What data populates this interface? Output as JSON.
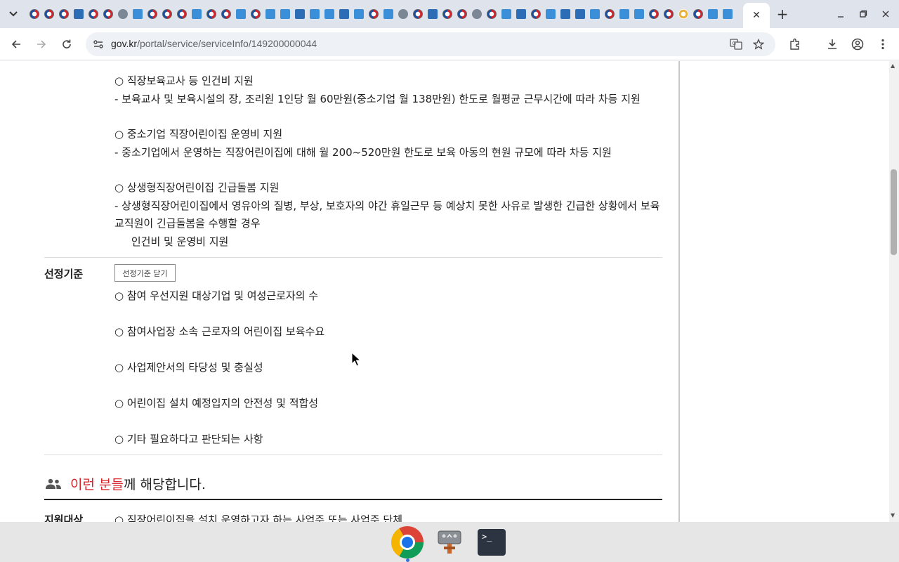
{
  "browser": {
    "tab_count_icons": 48,
    "active_tab_close": "✕",
    "new_tab": "+",
    "url_host": "gov.kr",
    "url_path": "/portal/service/serviceInfo/149200000044"
  },
  "content": {
    "support_items": [
      "○ 직장보육교사 등 인건비 지원",
      " - 보육교사 및 보육시설의 장, 조리원 1인당 월 60만원(중소기업 월 138만원) 한도로 월평균 근무시간에 따라 차등 지원",
      "○ 중소기업 직장어린이집 운영비 지원",
      " - 중소기업에서 운영하는 직장어린이집에 대해 월 200~520만원 한도로 보육 아동의 현원 규모에 따라 차등 지원",
      "○ 상생형직장어린이집 긴급돌봄 지원",
      " -  상생형직장어린이집에서 영유아의 질병, 부상, 보호자의 야간 휴일근무 등 예상치 못한 사유로 발생한 긴급한 상황에서 보육",
      "교직원이 긴급돌봄을 수행할 경우",
      "     인건비 및 운영비 지원"
    ],
    "criteria_label": "선정기준",
    "criteria_toggle": "선정기준 닫기",
    "criteria_items": [
      "○ 참여 우선지원 대상기업 및 여성근로자의 수",
      "○ 참여사업장 소속 근로자의 어린이집 보육수요",
      "○ 사업제안서의 타당성 및 충실성",
      "○ 어린이집 설치 예정입지의 안전성 및 적합성",
      "○ 기타 필요하다고 판단되는 사항"
    ],
    "heading_accent": "이런 분들",
    "heading_rest": "께 해당합니다.",
    "target_label": "지원대상",
    "target_first": "○ 직장어린이집을 설치 운영하고자 하는 사업주 또는 사업주 단체"
  },
  "colors": {
    "accent_red": "#d7262b",
    "tabstrip_bg": "#dfe3eb",
    "omnibox_bg": "#eef1f6"
  },
  "taskbar": {
    "apps": [
      "chrome-icon",
      "tool-icon",
      "terminal-icon"
    ],
    "terminal_glyph": ">_"
  }
}
